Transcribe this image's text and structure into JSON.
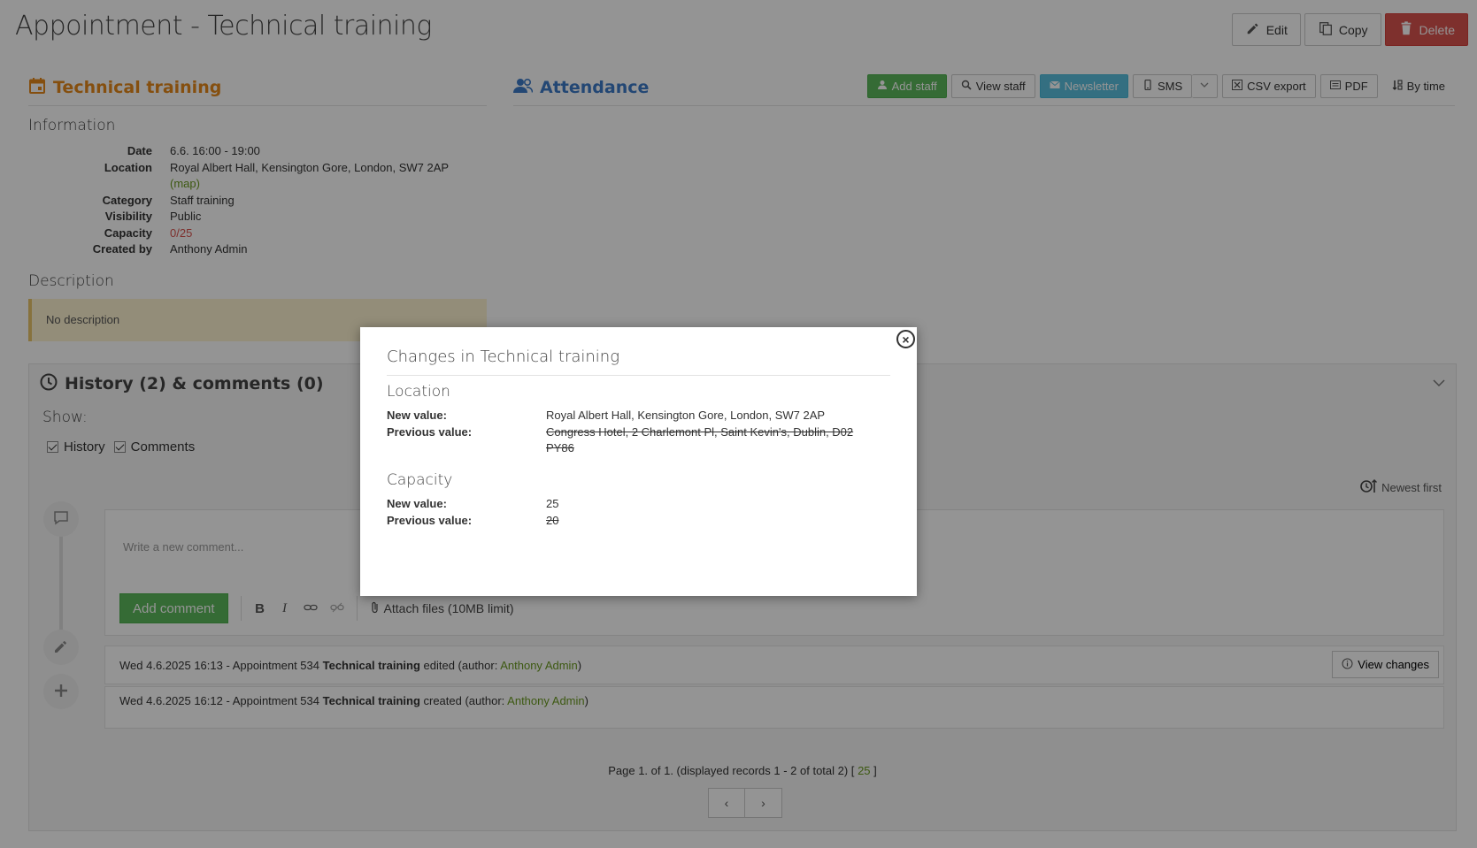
{
  "page": {
    "title": "Appointment - Technical training",
    "actions": {
      "edit": "Edit",
      "copy": "Copy",
      "delete": "Delete"
    }
  },
  "event": {
    "heading": "Technical training",
    "information_title": "Information",
    "fields": {
      "date_label": "Date",
      "date": "6.6. 16:00 - 19:00",
      "location_label": "Location",
      "location": "Royal Albert Hall, Kensington Gore, London, SW7 2AP",
      "map_link": "(map)",
      "category_label": "Category",
      "category": "Staff training",
      "visibility_label": "Visibility",
      "visibility": "Public",
      "capacity_label": "Capacity",
      "capacity": "0/25",
      "created_by_label": "Created by",
      "created_by": "Anthony Admin"
    },
    "description_title": "Description",
    "description": "No description"
  },
  "attendance": {
    "heading": "Attendance",
    "tools": {
      "add_staff": "Add staff",
      "view_staff": "View staff",
      "newsletter": "Newsletter",
      "sms": "SMS",
      "csv_export": "CSV export",
      "pdf": "PDF",
      "by_time": "By time"
    }
  },
  "history": {
    "heading": "History (2) & comments (0)",
    "show_label": "Show:",
    "filters": {
      "history": "History",
      "comments": "Comments"
    },
    "sort": "Newest first",
    "comment_placeholder": "Write a new comment...",
    "add_comment": "Add comment",
    "attach": "Attach files (10MB limit)",
    "entries": [
      {
        "prefix": "Wed 4.6.2025 16:13 - Appointment 534 ",
        "name": "Technical training",
        "mid": " edited (author: ",
        "author": "Anthony Admin",
        "suffix": ")",
        "action": "View changes"
      },
      {
        "prefix": "Wed 4.6.2025 16:12 - Appointment 534 ",
        "name": "Technical training",
        "mid": " created (author: ",
        "author": "Anthony Admin",
        "suffix": ")"
      }
    ],
    "pager_text": "Page 1. of 1. (displayed records 1 - 2 of total 2) [",
    "pager_size": "25",
    "pager_close": "]",
    "prev": "‹",
    "next": "›"
  },
  "modal": {
    "title": "Changes in Technical training",
    "close": "×",
    "changes": [
      {
        "field": "Location",
        "new_label": "New value:",
        "new": "Royal Albert Hall, Kensington Gore, London, SW7 2AP",
        "old_label": "Previous value:",
        "old": "Congress Hotel, 2 Charlemont Pl, Saint Kevin's, Dublin, D02 PY86"
      },
      {
        "field": "Capacity",
        "new_label": "New value:",
        "new": "25",
        "old_label": "Previous value:",
        "old": "20"
      }
    ]
  },
  "colors": {
    "accent_orange": "#e6891a",
    "accent_blue": "#3d7ac8",
    "success": "#5cb85c",
    "danger": "#d9534f",
    "info": "#5bc0de",
    "link_green": "#6a9a1f"
  }
}
